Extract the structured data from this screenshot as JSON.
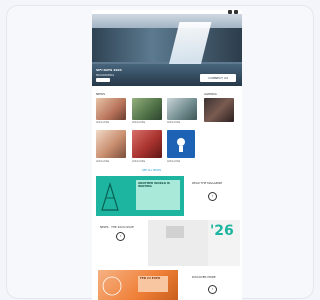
{
  "hero": {
    "title": "SIFI DAYS 2024",
    "subtitle": "PROGRAMMAS",
    "badge": "CONNECT 24"
  },
  "sections": {
    "left_label": "NEWS",
    "right_label": "AGENDA",
    "more_link": "SEE ALL NEWS"
  },
  "thumb_captions": [
    "Article title",
    "Article title",
    "Article title",
    "Article title",
    "Article title",
    "Article title"
  ],
  "promos": {
    "teal_headline": "ANOTHER WORLD IS WAITING",
    "teal_text": "READ THE MAGAZINE",
    "gray_text": "NEWS · THE 2024 ISSUE",
    "gray_number": "'26",
    "orange_headline": "FEB 24 EXPO",
    "orange_text": "DISCOVER MORE"
  },
  "colors": {
    "accent_blue": "#2a9fd6",
    "teal": "#1db59f",
    "orange": "#ef7f36"
  }
}
